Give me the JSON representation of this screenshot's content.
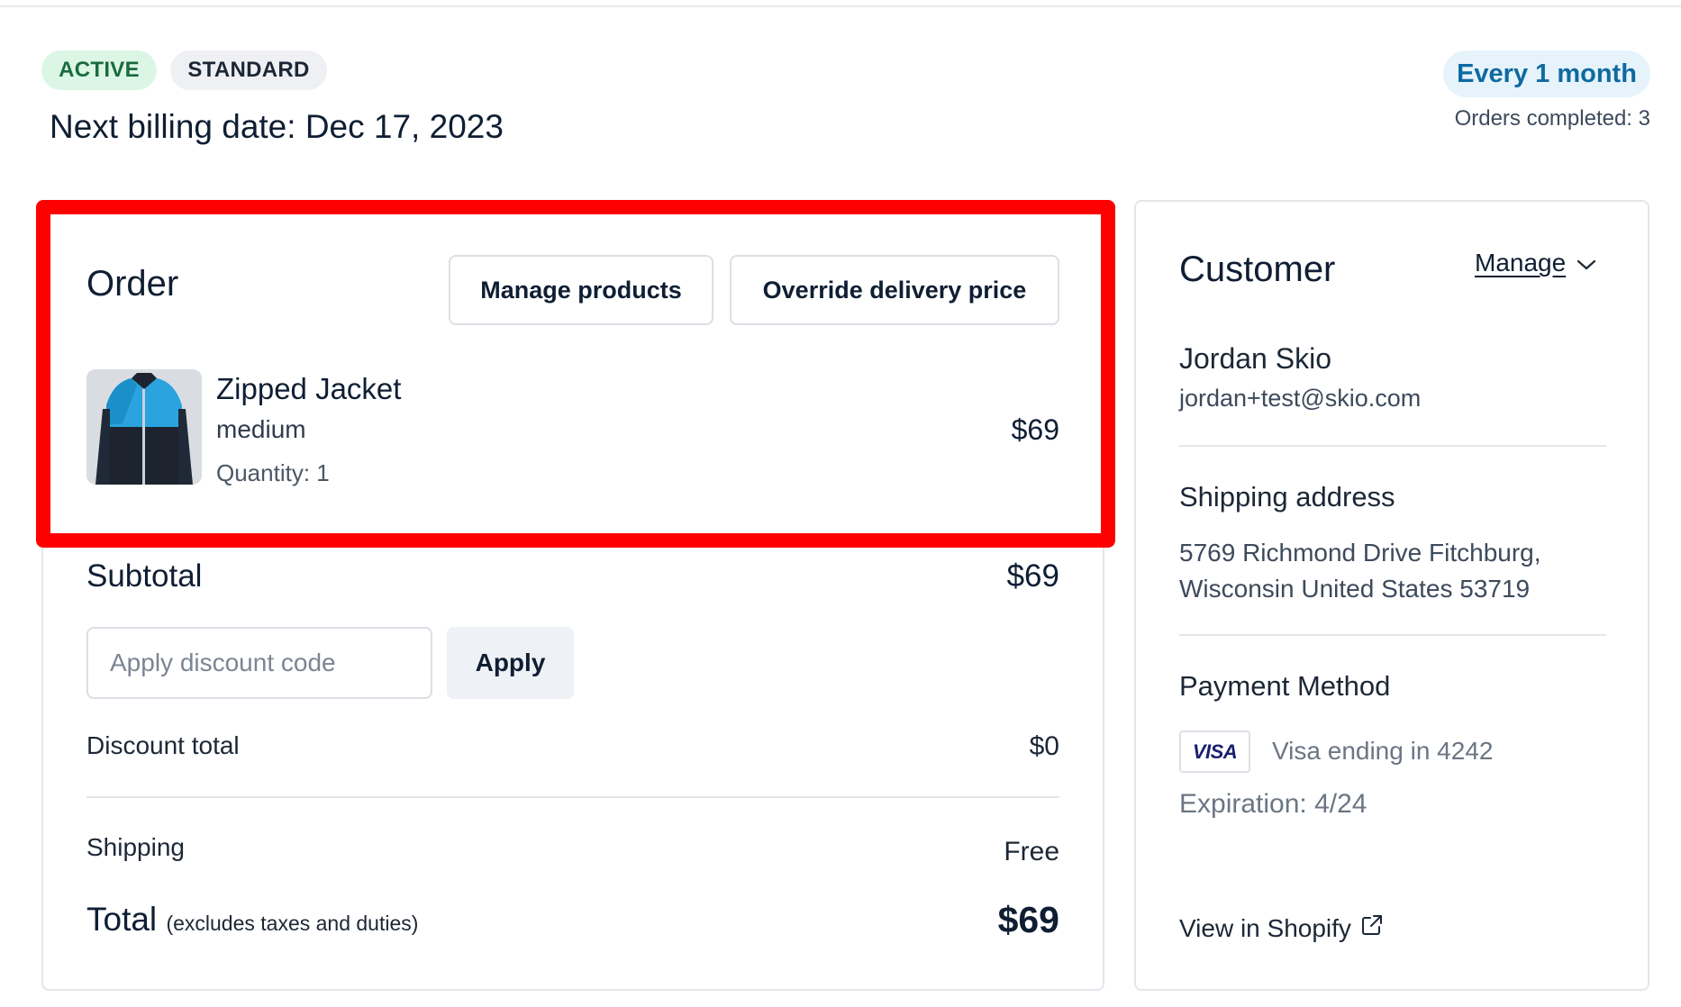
{
  "header": {
    "status_badge": "ACTIVE",
    "plan_badge": "STANDARD",
    "next_billing": "Next billing date: Dec 17, 2023",
    "frequency": "Every 1 month",
    "orders_completed": "Orders completed: 3"
  },
  "order": {
    "title": "Order",
    "manage_products_label": "Manage products",
    "override_delivery_label": "Override delivery price",
    "item": {
      "name": "Zipped Jacket",
      "variant": "medium",
      "quantity": "Quantity: 1",
      "price": "$69"
    },
    "subtotal_label": "Subtotal",
    "subtotal_value": "$69",
    "discount_placeholder": "Apply discount code",
    "apply_label": "Apply",
    "discount_total_label": "Discount total",
    "discount_total_value": "$0",
    "shipping_label": "Shipping",
    "shipping_value": "Free",
    "total_label": "Total",
    "total_note": "(excludes taxes and duties)",
    "total_value": "$69"
  },
  "customer": {
    "title": "Customer",
    "manage_label": "Manage",
    "name": "Jordan Skio",
    "email": "jordan+test@skio.com",
    "shipping_title": "Shipping address",
    "address_line1": "5769 Richmond Drive Fitchburg,",
    "address_line2": "Wisconsin United States 53719",
    "payment_title": "Payment Method",
    "card_brand": "VISA",
    "card_ending": "Visa ending in 4242",
    "expiration": "Expiration: 4/24",
    "shopify_link": "View in Shopify"
  },
  "colors": {
    "highlight": "#ff0000",
    "active_badge_bg": "#dcf6e6",
    "frequency_bg": "#e6f3fb",
    "frequency_text": "#0e6aa0"
  },
  "icons": {
    "manage_caret": "chevron-down-icon",
    "shopify_link": "external-link-icon",
    "product_thumb": "jacket-image"
  }
}
